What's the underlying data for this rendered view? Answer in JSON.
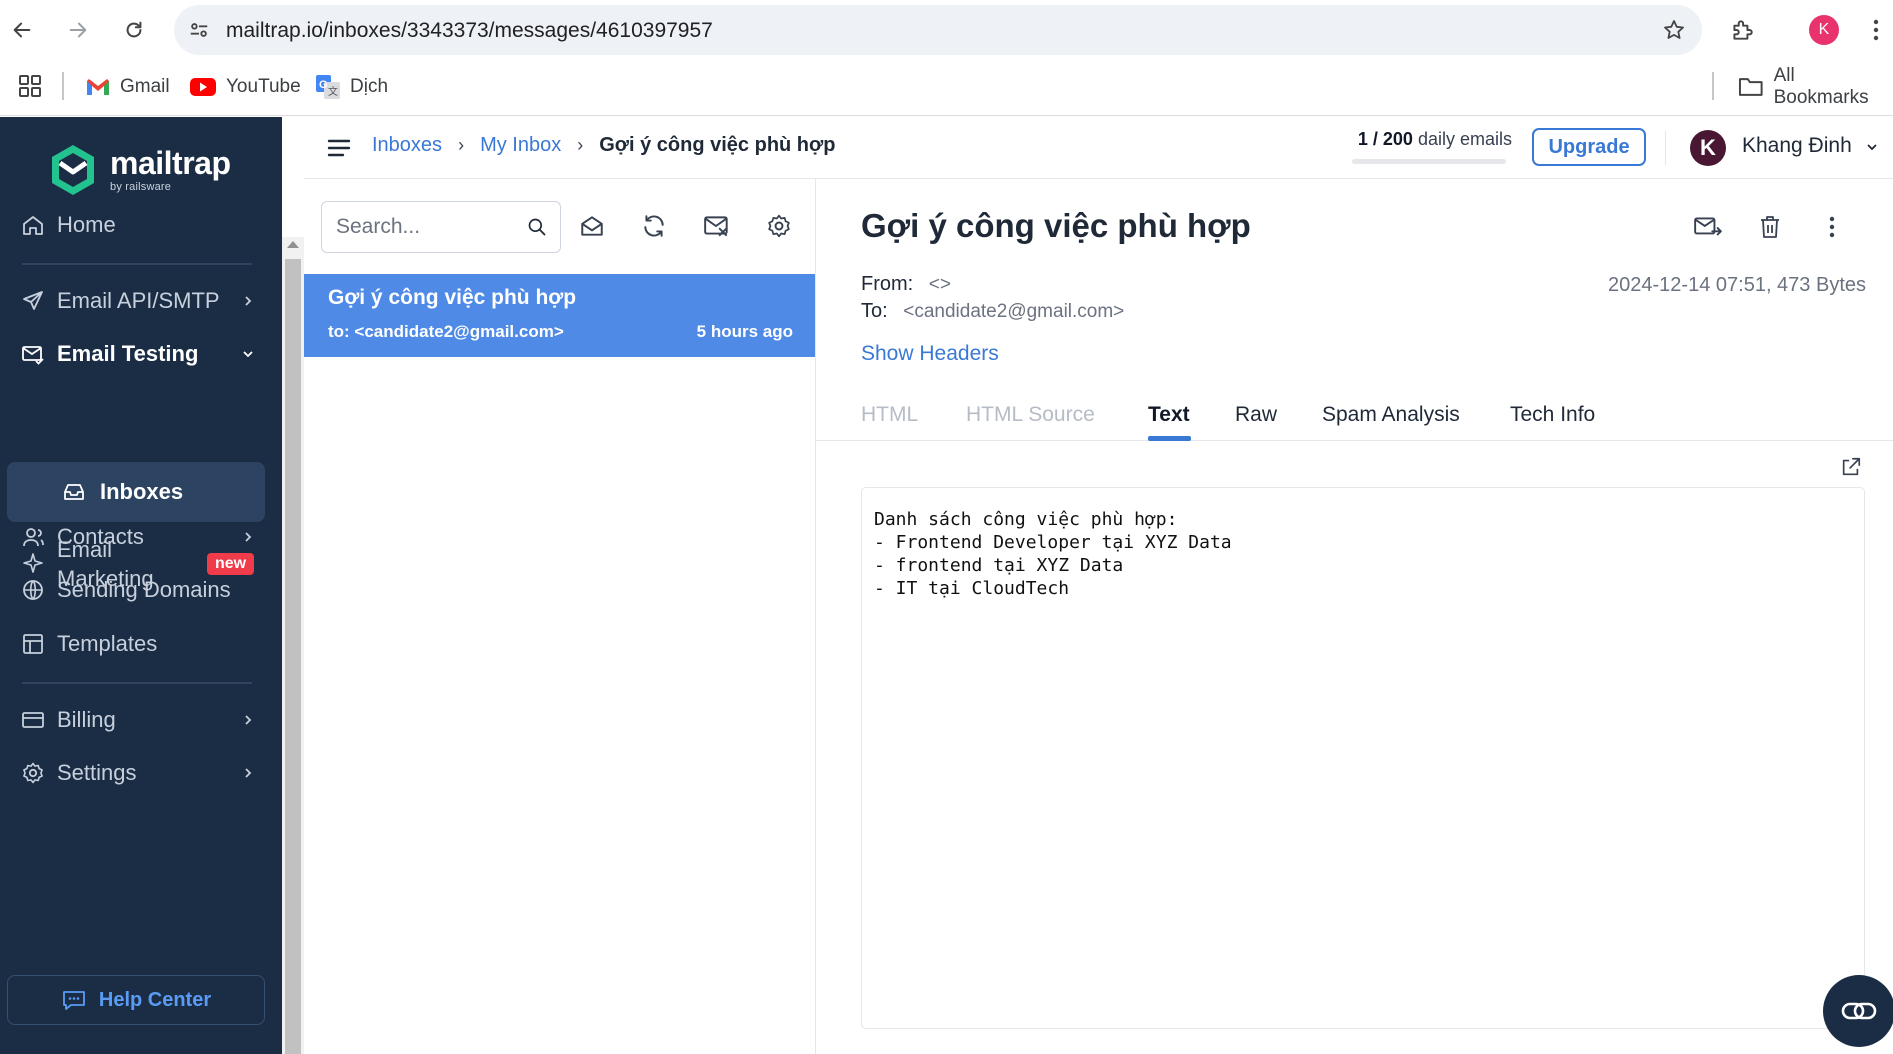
{
  "browser": {
    "url": "mailtrap.io/inboxes/3343373/messages/4610397957",
    "profile_initial": "K",
    "bookmarks": [
      {
        "label": "Gmail",
        "icon": "gmail-icon"
      },
      {
        "label": "YouTube",
        "icon": "youtube-icon"
      },
      {
        "label": "Dịch",
        "icon": "translate-icon"
      }
    ],
    "all_bookmarks": "All Bookmarks"
  },
  "sidebar": {
    "logo": "mailtrap",
    "logo_sub": "by railsware",
    "items": {
      "home": "Home",
      "email_api": "Email API/SMTP",
      "email_testing": "Email Testing",
      "inboxes": "Inboxes",
      "email_marketing": "Email Marketing",
      "new_badge": "new",
      "contacts": "Contacts",
      "sending_domains": "Sending Domains",
      "templates": "Templates",
      "billing": "Billing",
      "settings": "Settings"
    },
    "help_center": "Help Center"
  },
  "header": {
    "breadcrumbs": [
      "Inboxes",
      "My Inbox",
      "Gợi ý công việc phù hợp"
    ],
    "daily_count": "1 / 200",
    "daily_label": "daily emails",
    "daily_fraction": 0.005,
    "upgrade": "Upgrade",
    "user_initial": "K",
    "user_name": "Khang Đinh"
  },
  "list": {
    "search_placeholder": "Search...",
    "messages": [
      {
        "subject": "Gợi ý công việc phù hợp",
        "to": "to: <candidate2@gmail.com>",
        "time": "5 hours ago"
      }
    ]
  },
  "detail": {
    "title": "Gợi ý công việc phù hợp",
    "from_label": "From:",
    "from_value": "<>",
    "to_label": "To:",
    "to_value": "<candidate2@gmail.com>",
    "meta": "2024-12-14 07:51, 473 Bytes",
    "show_headers": "Show Headers",
    "tabs": [
      "HTML",
      "HTML Source",
      "Text",
      "Raw",
      "Spam Analysis",
      "Tech Info"
    ],
    "active_tab": "Text",
    "body": "Danh sách công việc phù hợp:\n- Frontend Developer tại XYZ Data\n- frontend tại XYZ Data\n- IT tại CloudTech"
  },
  "colors": {
    "sidebar_bg": "#1b2d44",
    "accent": "#3a78d6",
    "selected_message": "#4f8ae6",
    "new_badge": "#ef3b4a",
    "logo_green": "#22c38e"
  }
}
